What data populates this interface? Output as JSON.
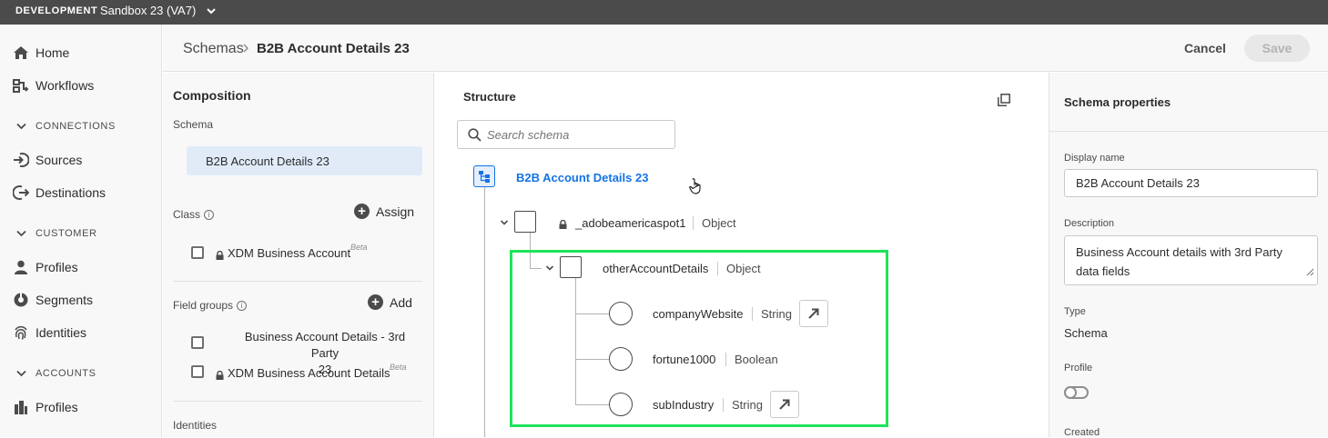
{
  "topbar": {
    "env": "DEVELOPMENT",
    "sandbox": "Sandbox 23 (VA7)"
  },
  "nav": {
    "home": "Home",
    "workflows": "Workflows",
    "connections": "CONNECTIONS",
    "sources": "Sources",
    "destinations": "Destinations",
    "customer": "CUSTOMER",
    "profiles": "Profiles",
    "segments": "Segments",
    "identities": "Identities",
    "accounts": "ACCOUNTS",
    "account_profiles": "Profiles"
  },
  "header": {
    "breadcrumb_root": "Schemas",
    "breadcrumb_current": "B2B Account Details 23",
    "cancel": "Cancel",
    "save": "Save"
  },
  "composition": {
    "title": "Composition",
    "schema_label": "Schema",
    "schema_name": "B2B Account Details 23",
    "class_label": "Class",
    "assign": "Assign",
    "class_item": "XDM Business Account",
    "beta": "Beta",
    "field_groups_label": "Field groups",
    "add": "Add",
    "field_group_1_line1": "Business Account Details - 3rd Party",
    "field_group_1_line2": "23",
    "field_group_2": "XDM Business Account Details",
    "identities_label": "Identities"
  },
  "structure": {
    "title": "Structure",
    "search_placeholder": "Search schema",
    "root": "B2B Account Details 23",
    "nodes": [
      {
        "name": "_adobeamericaspot1",
        "type": "Object"
      },
      {
        "name": "otherAccountDetails",
        "type": "Object"
      },
      {
        "name": "companyWebsite",
        "type": "String"
      },
      {
        "name": "fortune1000",
        "type": "Boolean"
      },
      {
        "name": "subIndustry",
        "type": "String"
      }
    ]
  },
  "properties": {
    "title": "Schema properties",
    "display_name_label": "Display name",
    "display_name": "B2B Account Details 23",
    "description_label": "Description",
    "description": "Business Account details with 3rd Party data fields",
    "type_label": "Type",
    "type_value": "Schema",
    "profile_label": "Profile",
    "profile_enabled": false,
    "created_label": "Created"
  },
  "colors": {
    "accent": "#1473e6",
    "highlight": "#1ee35b"
  }
}
